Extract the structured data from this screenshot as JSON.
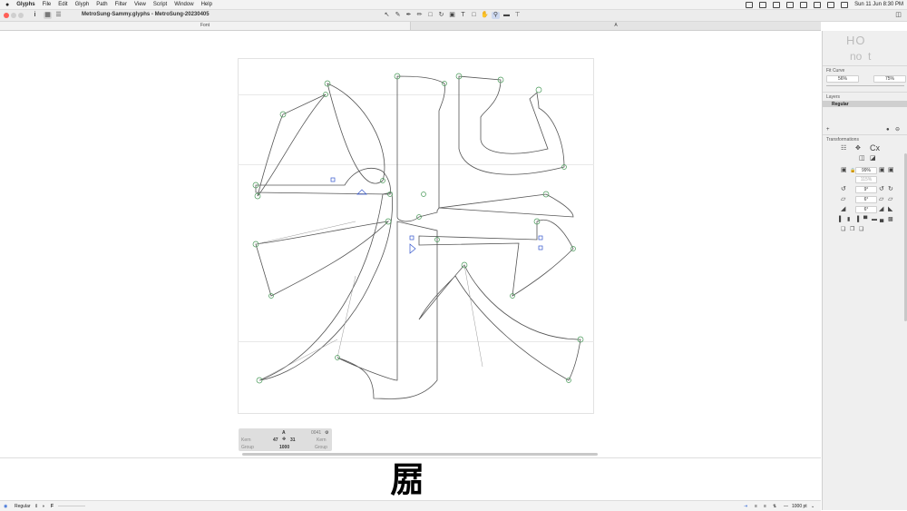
{
  "menubar": {
    "apple": "",
    "items": [
      "Glyphs",
      "File",
      "Edit",
      "Glyph",
      "Path",
      "Filter",
      "View",
      "Script",
      "Window",
      "Help"
    ],
    "datetime": "Sun 11 Jun  8:30 PM"
  },
  "toolbar": {
    "title": "MetroSung-Sammy.glyphs - MetroSung-20230405",
    "info_icon": "i",
    "tools": [
      "select-tool",
      "draw-tool",
      "pen-tool",
      "pencil-tool",
      "brush-tool",
      "rectangle-tool",
      "ellipse-tool",
      "rotate-tool",
      "scale-tool",
      "text-tool",
      "annotation-tool",
      "hand-tool",
      "zoom-tool",
      "measure-tool",
      "type-tool"
    ]
  },
  "tabs": {
    "left": "Font",
    "right": "A"
  },
  "info_box": {
    "glyph_name": "A",
    "unicode": "0041",
    "kern_left_label": "Kern",
    "kern_right_label": "Kern",
    "lsb": "47",
    "rsb": "31",
    "group_left_label": "Group",
    "group_right_label": "Group",
    "width": "1000"
  },
  "preview": {
    "glyph": "𡲢"
  },
  "bottombar": {
    "layer": "Regular",
    "size": "1000 pt"
  },
  "panel": {
    "preview_text_top": "HO",
    "preview_text_bottom": "no  t",
    "fit_curve_label": "Fit Curve",
    "fit_curve_left": "56%",
    "fit_curve_right": "75%",
    "layers_label": "Layers",
    "layer_name": "Regular",
    "transformations_label": "Transformations",
    "scale_value": "99%",
    "scale_value2": "115%",
    "rotate_value": "9°",
    "slant_value": "6°",
    "slant_value2": "6°"
  },
  "colors": {
    "node": "#4a9a5a",
    "outline": "#555555",
    "handle": "#9a9a9a",
    "anchor": "#3355cc",
    "selected_layer": "#cfcfcf"
  }
}
